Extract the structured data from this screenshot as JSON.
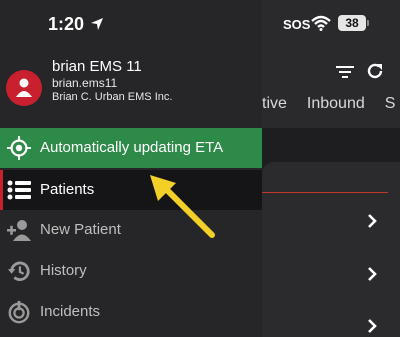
{
  "status_bar": {
    "time": "1:20",
    "carrier": "SOS",
    "battery": "38"
  },
  "background": {
    "tabs": [
      "tive",
      "Inbound",
      "S"
    ]
  },
  "profile": {
    "name": "brian EMS 11",
    "username": "brian.ems11",
    "organization": "Brian C. Urban EMS Inc."
  },
  "menu": {
    "eta_label": "Automatically updating ETA",
    "items": [
      {
        "label": "Patients"
      },
      {
        "label": "New Patient"
      },
      {
        "label": "History"
      },
      {
        "label": "Incidents"
      }
    ]
  },
  "colors": {
    "eta_green": "#2e8a48",
    "accent_red": "#c8202f",
    "arrow_yellow": "#f2d027"
  }
}
